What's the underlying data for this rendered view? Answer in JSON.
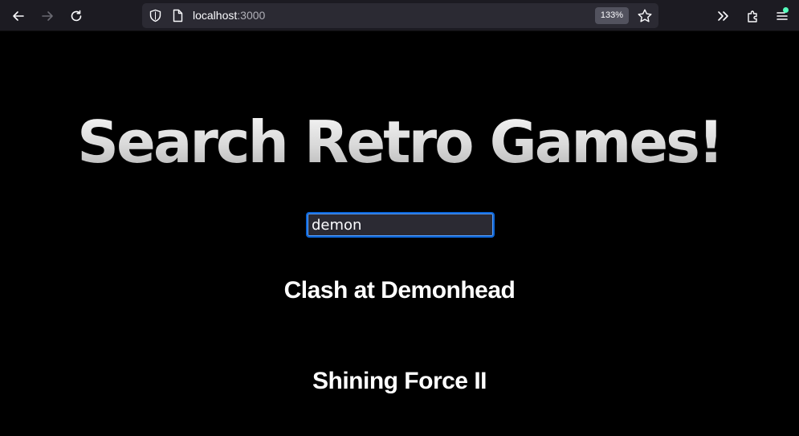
{
  "browser": {
    "url_host": "localhost",
    "url_port": ":3000",
    "zoom": "133%",
    "icons": {
      "back": "back-arrow-icon",
      "forward": "forward-arrow-icon",
      "reload": "reload-icon",
      "shield": "tracking-protection-shield-icon",
      "page": "page-info-icon",
      "bookmark": "bookmark-star-icon",
      "overflow": "chevron-double-right-icon",
      "extensions": "extensions-puzzle-icon",
      "menu": "hamburger-menu-icon"
    },
    "colors": {
      "toolbar": "#1c1b22",
      "urlbar": "#2b2a33",
      "notification_dot": "#54ffbd"
    }
  },
  "page": {
    "title": "Search Retro Games!",
    "search": {
      "value": "demon"
    },
    "results": [
      {
        "title": "Clash at Demonhead"
      },
      {
        "title": "Shining Force II"
      }
    ],
    "colors": {
      "background": "#000000",
      "input_focus_border": "#0b64d6"
    }
  }
}
